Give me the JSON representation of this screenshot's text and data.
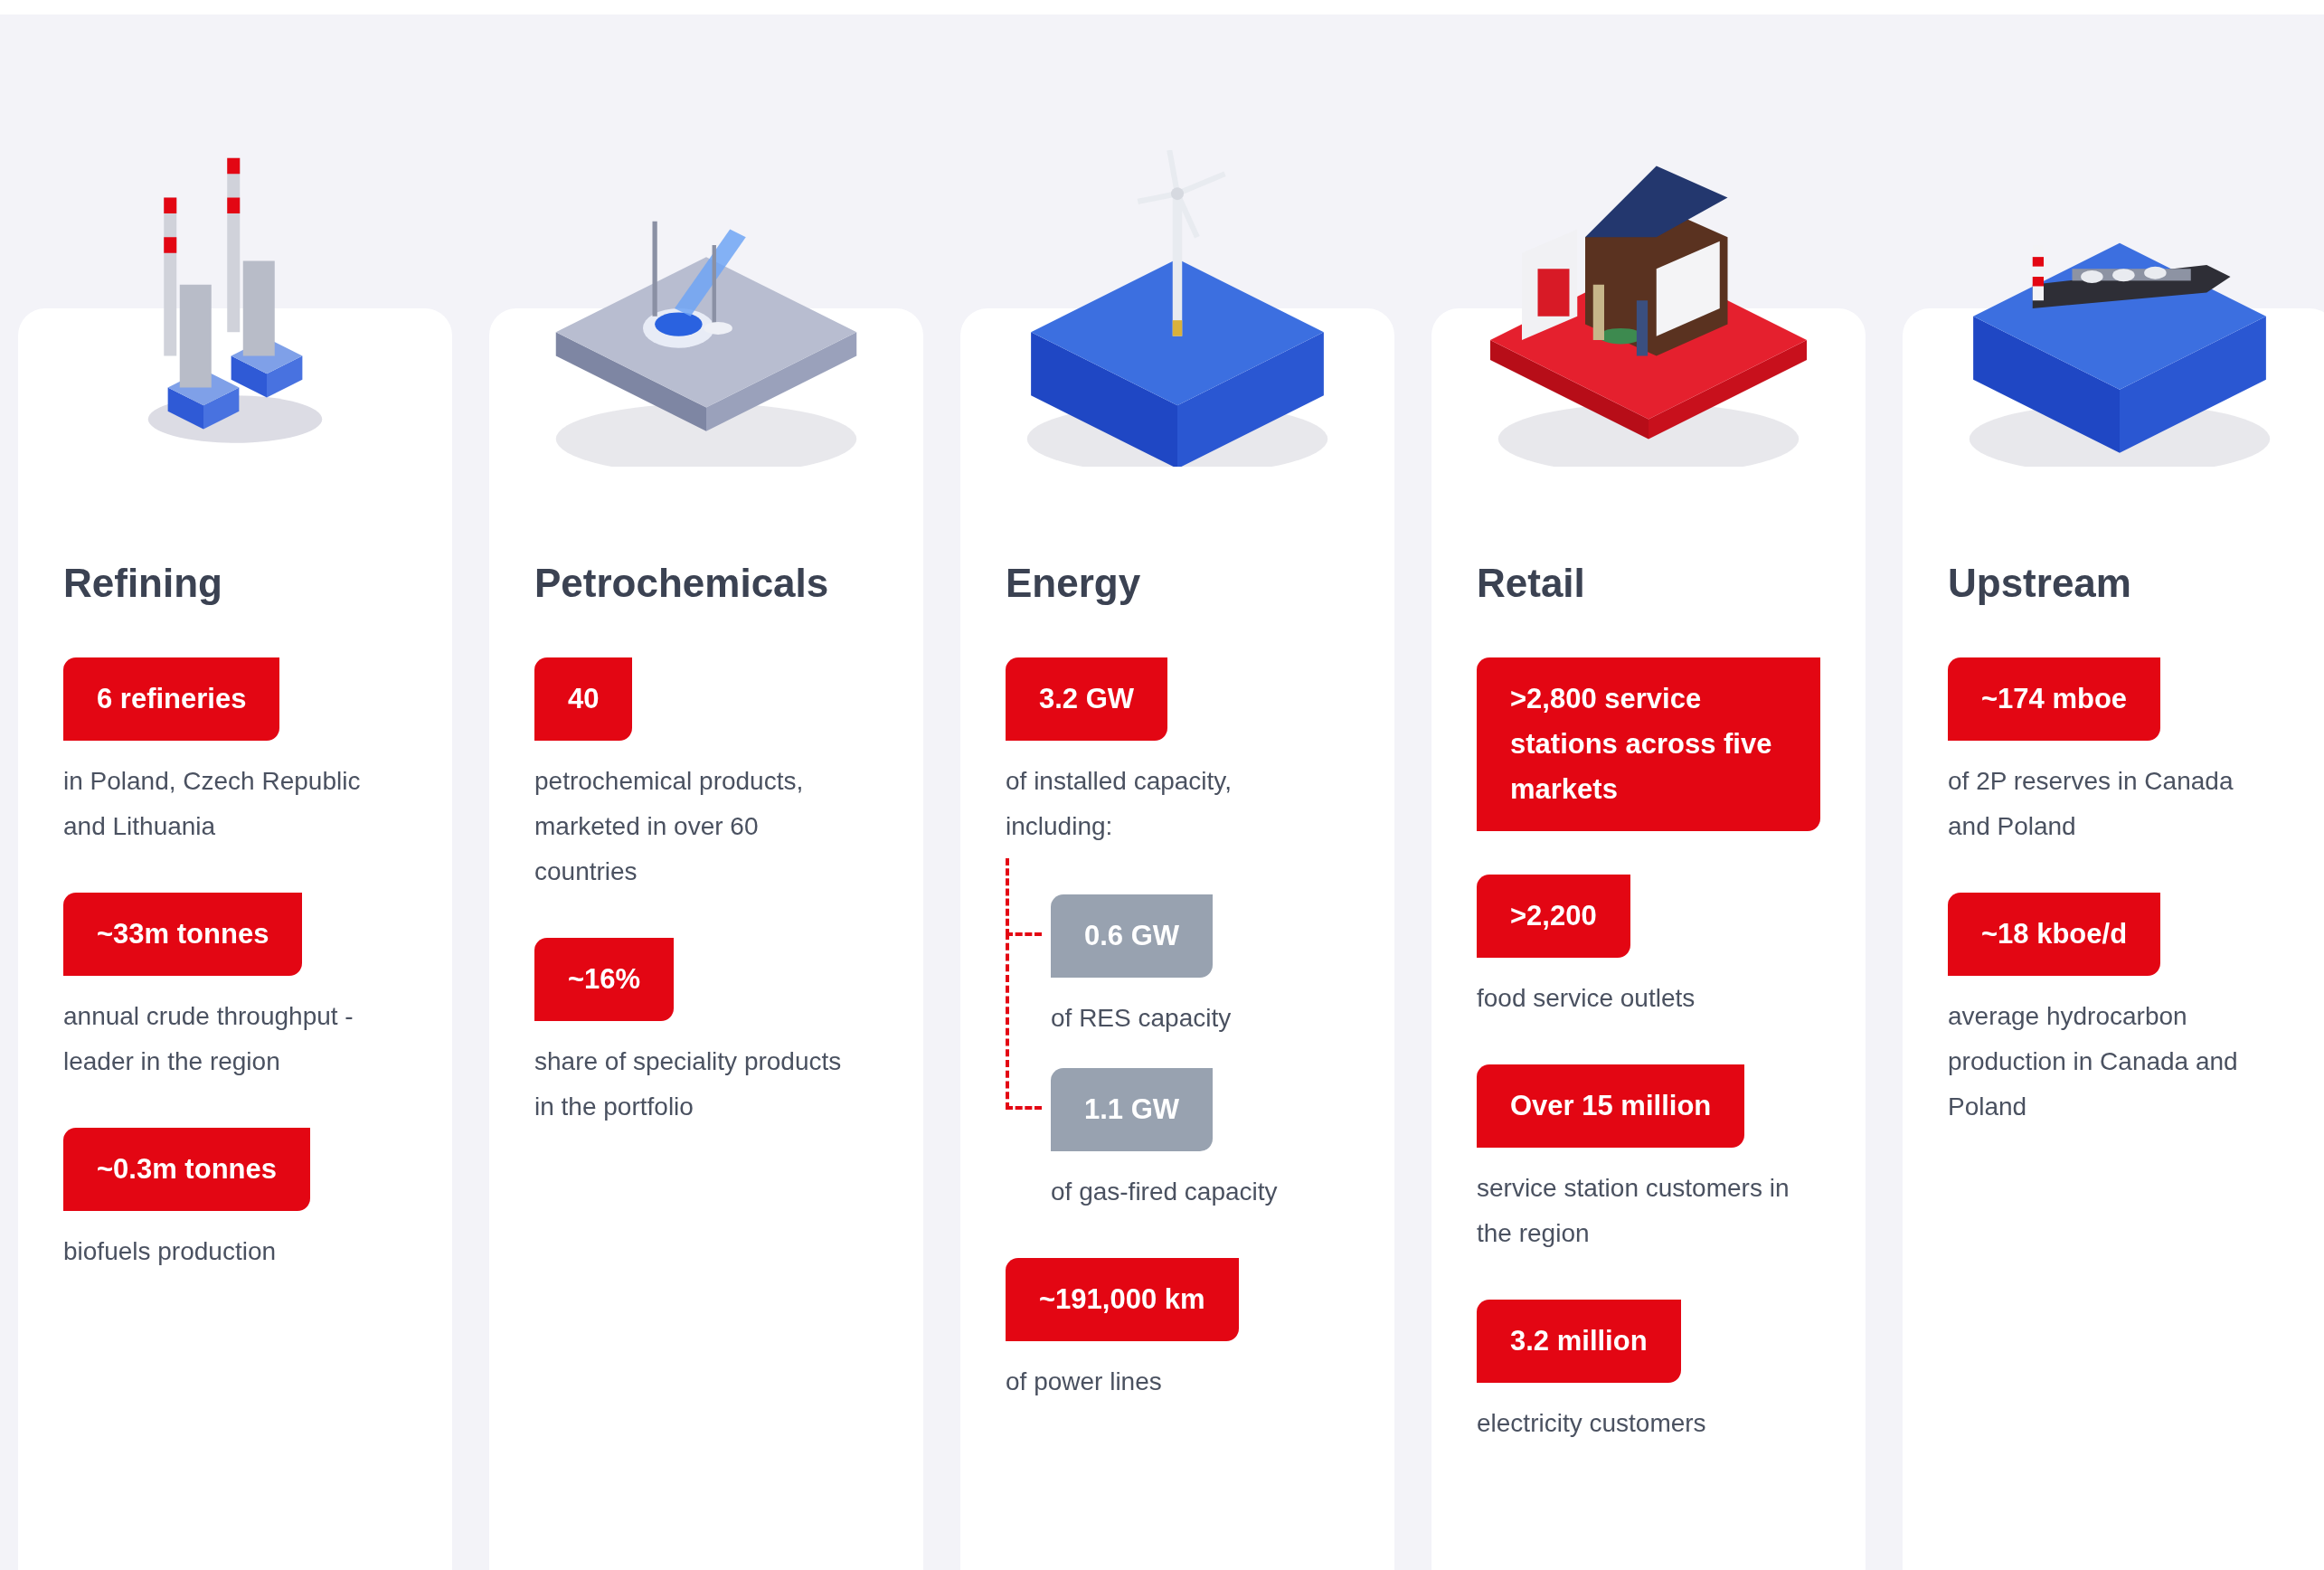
{
  "cards": [
    {
      "title": "Refining",
      "kind": "refinery",
      "stats": [
        {
          "kind": "main",
          "value": "6 refineries",
          "caption": "in Poland, Czech Republic and Lithuania"
        },
        {
          "kind": "main",
          "value": "~33m tonnes",
          "caption": "annual crude throughput - leader in the region"
        },
        {
          "kind": "main",
          "value": "~0.3m tonnes",
          "caption": "biofuels production"
        }
      ]
    },
    {
      "title": "Petrochemicals",
      "kind": "lab",
      "stats": [
        {
          "kind": "main",
          "value": "40",
          "caption": "petrochemical products, marketed in over 60 countries"
        },
        {
          "kind": "main",
          "value": "~16%",
          "caption": "share of speciality products in the portfolio"
        }
      ]
    },
    {
      "title": "Energy",
      "kind": "wind",
      "stats": [
        {
          "kind": "main",
          "value": "3.2 GW",
          "caption": "of installed capacity, including:",
          "children": [
            {
              "kind": "sub",
              "value": "0.6 GW",
              "caption": "of RES capacity"
            },
            {
              "kind": "sub",
              "value": "1.1 GW",
              "caption": "of gas-fired capacity"
            }
          ]
        },
        {
          "kind": "main",
          "value": "~191,000 km",
          "caption": "of power lines"
        }
      ]
    },
    {
      "title": "Retail",
      "kind": "station",
      "stats": [
        {
          "kind": "main",
          "value": ">2,800 service stations across five markets"
        },
        {
          "kind": "main",
          "value": ">2,200",
          "caption": "food service outlets"
        },
        {
          "kind": "main",
          "value": "Over 15 million",
          "caption": "service station customers in the region"
        },
        {
          "kind": "main",
          "value": "3.2 million",
          "caption": "electricity customers"
        }
      ]
    },
    {
      "title": "Upstream",
      "kind": "ship",
      "stats": [
        {
          "kind": "main",
          "value": "~174 mboe",
          "caption": "of 2P reserves in Canada and Poland"
        },
        {
          "kind": "main",
          "value": "~18 kboe/d",
          "caption": "average hydrocarbon production in Canada and Poland"
        }
      ]
    }
  ]
}
